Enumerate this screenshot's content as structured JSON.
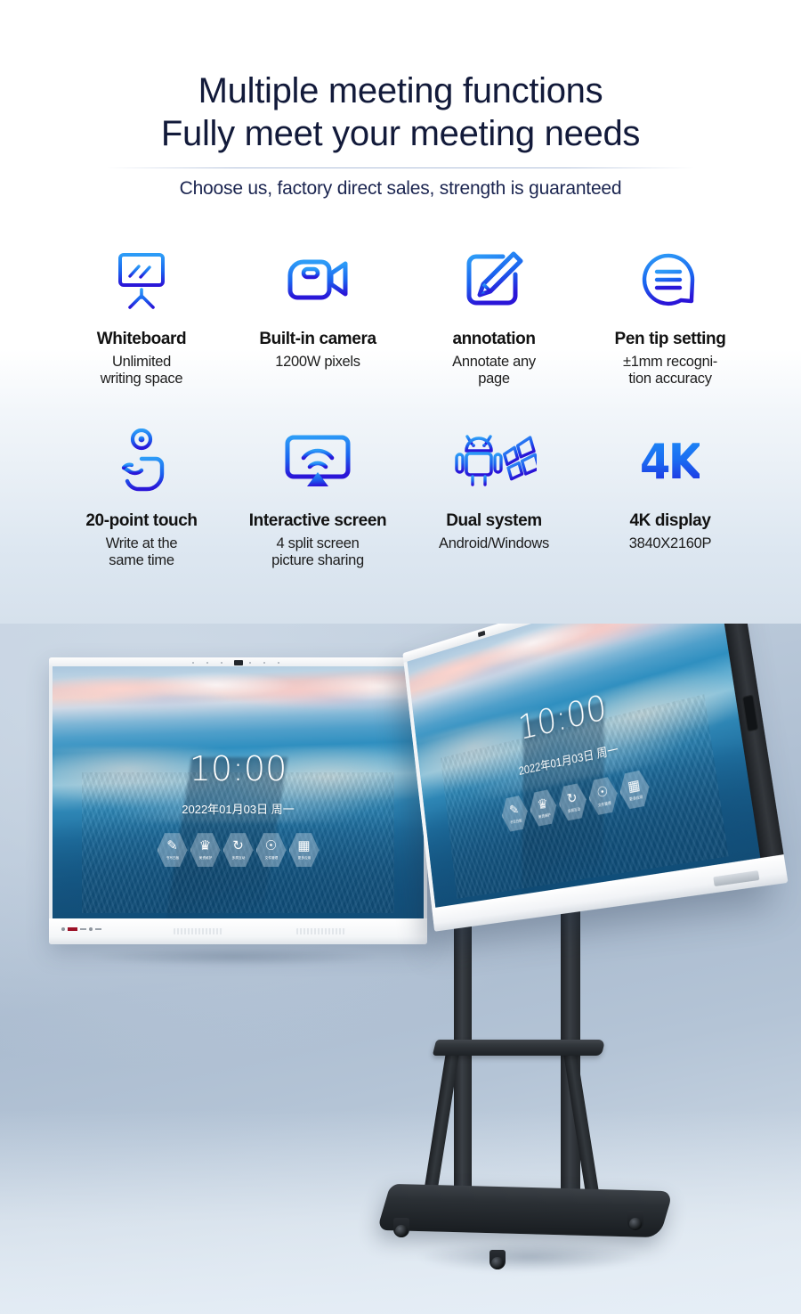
{
  "hero": {
    "headline_line1": "Multiple meeting functions",
    "headline_line2": "Fully meet your meeting needs",
    "subheadline": "Choose us, factory direct sales, strength is guaranteed",
    "heading_color": "#121a3a",
    "accent_color": "#1a6ef2"
  },
  "features": [
    {
      "icon": "whiteboard-icon",
      "title": "Whiteboard",
      "desc_line1": "Unlimited",
      "desc_line2": "writing space"
    },
    {
      "icon": "video-camera-icon",
      "title": "Built-in camera",
      "desc_line1": "1200W pixels",
      "desc_line2": ""
    },
    {
      "icon": "annotation-pencil-icon",
      "title": "annotation",
      "desc_line1": "Annotate any",
      "desc_line2": "page"
    },
    {
      "icon": "pen-tip-chat-icon",
      "title": "Pen tip setting",
      "desc_line1": "±1mm recogni-",
      "desc_line2": "tion accuracy"
    },
    {
      "icon": "touch-hand-icon",
      "title": "20-point touch",
      "desc_line1": "Write at the",
      "desc_line2": "same time"
    },
    {
      "icon": "screen-cast-icon",
      "title": "Interactive screen",
      "desc_line1": "4 split screen",
      "desc_line2": "picture sharing"
    },
    {
      "icon": "android-windows-icon",
      "title": "Dual system",
      "desc_line1": "Android/Windows",
      "desc_line2": ""
    },
    {
      "icon": "4k-badge-icon",
      "title": "4K display",
      "desc_line1": "3840X2160P",
      "desc_line2": "",
      "badge_text": "4K"
    }
  ],
  "product": {
    "display_a": {
      "name": "interactive-flat-panel-wall-mounted",
      "clock": "10:00",
      "date": "2022年01月03日 周一",
      "apps": [
        {
          "label": "书写白板",
          "glyph": "✎"
        },
        {
          "label": "美资维护",
          "glyph": "♛"
        },
        {
          "label": "多屏互动",
          "glyph": "↻"
        },
        {
          "label": "文件管理",
          "glyph": "☉"
        },
        {
          "label": "更多应用",
          "glyph": "▦"
        }
      ]
    },
    "display_b": {
      "name": "interactive-flat-panel-on-mobile-stand",
      "clock": "10:00",
      "date": "2022年01月03日 周一",
      "apps": [
        {
          "label": "书写白板",
          "glyph": "✎"
        },
        {
          "label": "美资维护",
          "glyph": "♛"
        },
        {
          "label": "多屏互动",
          "glyph": "↻"
        },
        {
          "label": "文件管理",
          "glyph": "☉"
        },
        {
          "label": "更多应用",
          "glyph": "▦"
        }
      ]
    },
    "wallpaper": "sunset-beach-tidal-flats",
    "background_color": "#b9c8d9"
  }
}
